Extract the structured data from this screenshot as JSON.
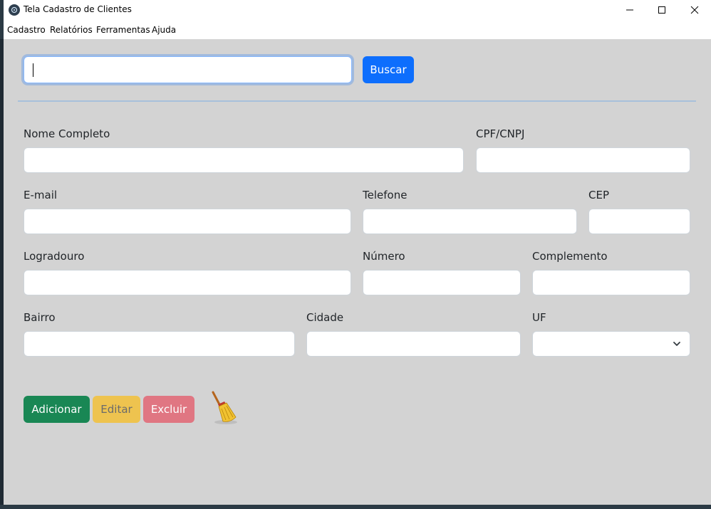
{
  "window": {
    "title": "Tela Cadastro de Clientes"
  },
  "menu": [
    "Cadastro",
    "Relatórios",
    "Ferramentas",
    "Ajuda"
  ],
  "search": {
    "value": "",
    "button_label": "Buscar"
  },
  "form": {
    "nome_label": "Nome Completo",
    "cpf_label": "CPF/CNPJ",
    "email_label": "E-mail",
    "telefone_label": "Telefone",
    "cep_label": "CEP",
    "logradouro_label": "Logradouro",
    "numero_label": "Número",
    "complemento_label": "Complemento",
    "bairro_label": "Bairro",
    "cidade_label": "Cidade",
    "uf_label": "UF",
    "uf_value": ""
  },
  "actions": {
    "adicionar": "Adicionar",
    "editar": "Editar",
    "excluir": "Excluir"
  },
  "colors": {
    "primary": "#0d6efd",
    "success": "#198754",
    "warning": "#eec34f",
    "danger": "#e07682",
    "background": "#d3d3d3"
  },
  "icons": [
    "app-icon",
    "minimize-icon",
    "maximize-icon",
    "close-icon",
    "chevron-down-icon",
    "broom-icon"
  ]
}
